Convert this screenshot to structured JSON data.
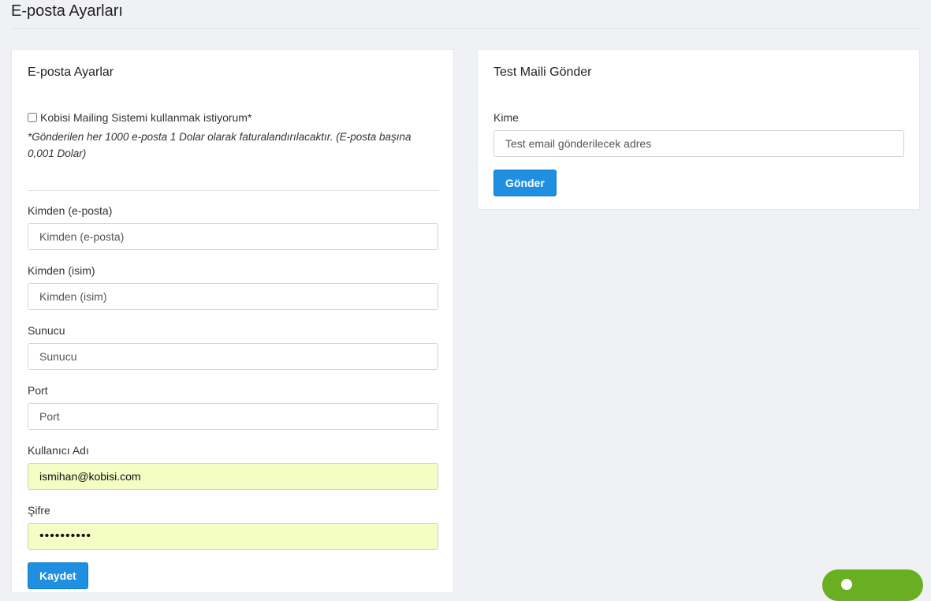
{
  "page": {
    "title": "E-posta Ayarları"
  },
  "email_settings": {
    "title": "E-posta Ayarlar",
    "checkbox_label": "Kobisi Mailing Sistemi kullanmak istiyorum*",
    "checkbox_checked": false,
    "note": "*Gönderilen her 1000 e-posta 1 Dolar olarak faturalandırılacaktır. (E-posta başına 0,001 Dolar)",
    "fields": {
      "from_email": {
        "label": "Kimden (e-posta)",
        "placeholder": "Kimden (e-posta)",
        "value": ""
      },
      "from_name": {
        "label": "Kimden (isim)",
        "placeholder": "Kimden (isim)",
        "value": ""
      },
      "server": {
        "label": "Sunucu",
        "placeholder": "Sunucu",
        "value": ""
      },
      "port": {
        "label": "Port",
        "placeholder": "Port",
        "value": ""
      },
      "username": {
        "label": "Kullanıcı Adı",
        "placeholder": "",
        "value": "ismihan@kobisi.com"
      },
      "password": {
        "label": "Şifre",
        "placeholder": "",
        "value": "••••••••••"
      }
    },
    "save_label": "Kaydet"
  },
  "test_mail": {
    "title": "Test Maili Gönder",
    "to_label": "Kime",
    "to_placeholder": "Test email gönderilecek adres",
    "send_label": "Gönder"
  },
  "colors": {
    "primary_button": "#1e8fe1",
    "autofill_background": "#f4fdc4",
    "chat_widget": "#6aae21",
    "page_background": "#f0f1f5"
  }
}
